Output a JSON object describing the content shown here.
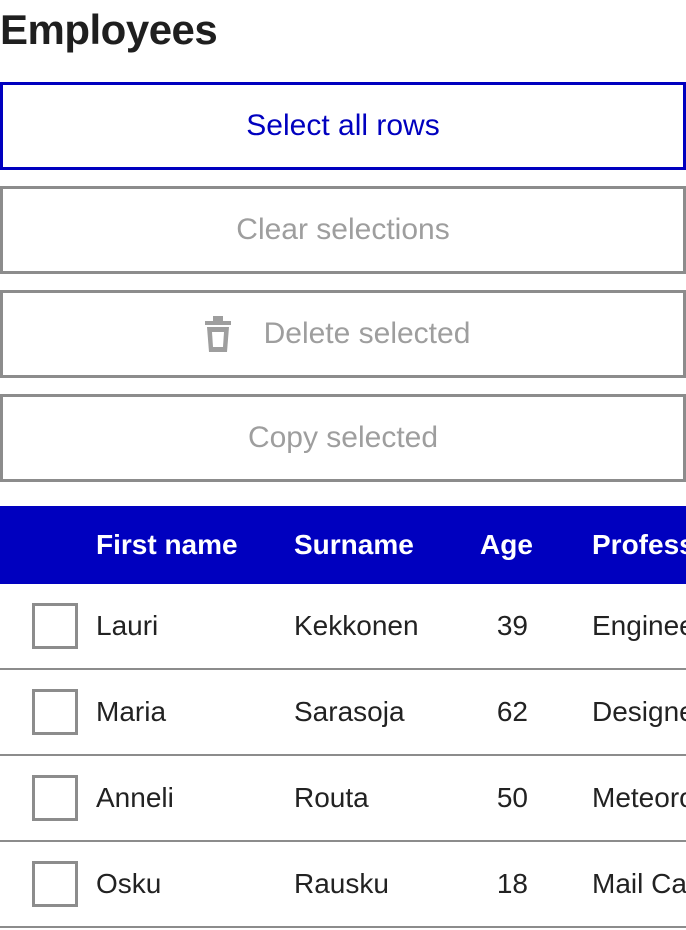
{
  "page": {
    "title": "Employees"
  },
  "actions": {
    "select_all": "Select all rows",
    "clear": "Clear selections",
    "delete": "Delete selected",
    "delete_icon": "trash-icon",
    "copy": "Copy selected"
  },
  "colors": {
    "primary": "#0000bf",
    "disabled_border": "#8c8c8c",
    "disabled_text": "#9e9e9e"
  },
  "table": {
    "headers": {
      "first_name": "First name",
      "surname": "Surname",
      "age": "Age",
      "profession": "Profess"
    },
    "rows": [
      {
        "first_name": "Lauri",
        "surname": "Kekkonen",
        "age": "39",
        "profession": "Enginee",
        "checked": false
      },
      {
        "first_name": "Maria",
        "surname": "Sarasoja",
        "age": "62",
        "profession": "Designe",
        "checked": false
      },
      {
        "first_name": "Anneli",
        "surname": "Routa",
        "age": "50",
        "profession": "Meteoro",
        "checked": false
      },
      {
        "first_name": "Osku",
        "surname": "Rausku",
        "age": "18",
        "profession": "Mail Car",
        "checked": false
      }
    ]
  }
}
